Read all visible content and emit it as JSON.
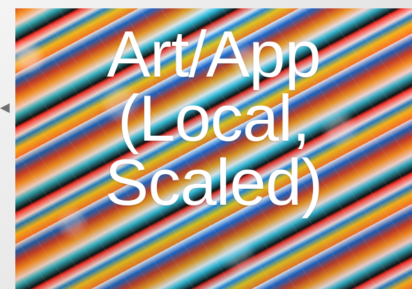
{
  "slide": {
    "title_lines": [
      "Art/App",
      "(Local,",
      "Scaled)"
    ]
  },
  "icons": {
    "left_arrow": "arrow-left-icon"
  }
}
